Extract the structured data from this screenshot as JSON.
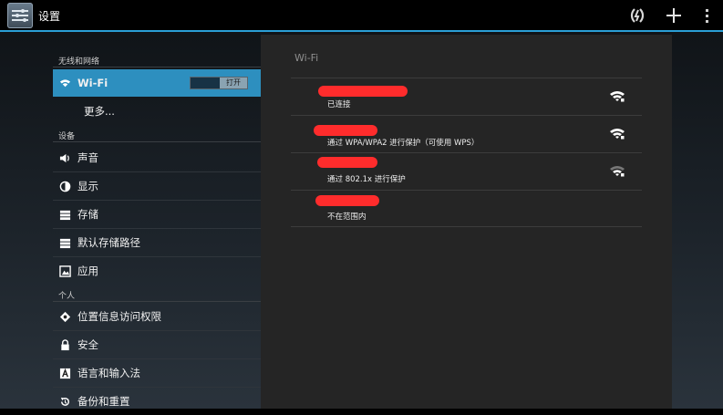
{
  "actionbar": {
    "title": "设置",
    "app_icon": "settings-app-icon",
    "actions": [
      {
        "name": "wps-icon"
      },
      {
        "name": "add-icon"
      },
      {
        "name": "overflow-menu-icon"
      }
    ],
    "accent_color": "#2a9fd6"
  },
  "sidebar": {
    "sections": [
      {
        "label": "无线和网络"
      },
      {
        "label": "设备"
      },
      {
        "label": "个人"
      }
    ],
    "items": [
      {
        "label": "Wi-Fi",
        "icon": "wifi-icon",
        "selected": true
      },
      {
        "label": "更多...",
        "icon": ""
      },
      {
        "label": "声音",
        "icon": "volume-icon"
      },
      {
        "label": "显示",
        "icon": "display-icon"
      },
      {
        "label": "存储",
        "icon": "storage-icon"
      },
      {
        "label": "默认存储路径",
        "icon": "storage-path-icon"
      },
      {
        "label": "应用",
        "icon": "apps-icon"
      },
      {
        "label": "位置信息访问权限",
        "icon": "location-icon"
      },
      {
        "label": "安全",
        "icon": "lock-icon"
      },
      {
        "label": "语言和输入法",
        "icon": "language-icon"
      },
      {
        "label": "备份和重置",
        "icon": "backup-icon"
      }
    ],
    "wifi_toggle": {
      "state_label": "打开",
      "on": true
    },
    "selected_color": "#2d8fbf"
  },
  "detail": {
    "title": "Wi-Fi",
    "networks": [
      {
        "status": "已连接",
        "signal": "strong"
      },
      {
        "status": "通过 WPA/WPA2 进行保护（可使用 WPS）",
        "signal": "strong"
      },
      {
        "status": "通过 802.1x 进行保护",
        "signal": "medium"
      },
      {
        "status": "不在范围内",
        "signal": "none"
      }
    ],
    "redaction_color": "#ff2c2c"
  }
}
